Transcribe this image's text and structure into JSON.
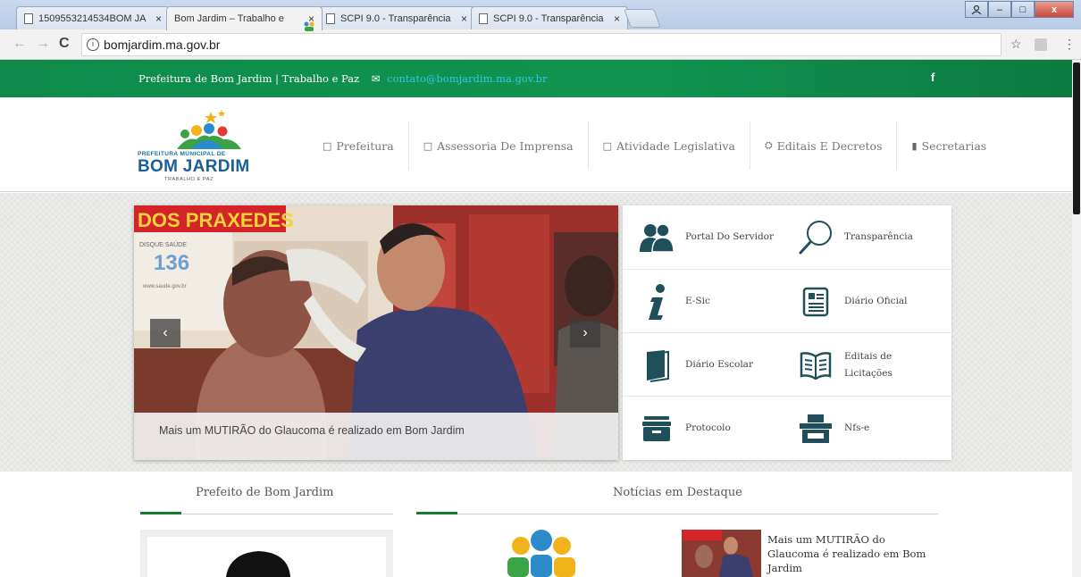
{
  "browser": {
    "tabs": [
      {
        "title": "1509553214534BOM JA",
        "icon": "page-icon"
      },
      {
        "title": "Bom Jardim – Trabalho e",
        "icon": "site-logo-icon"
      },
      {
        "title": "SCPI 9.0 - Transparência",
        "icon": "page-icon"
      },
      {
        "title": "SCPI 9.0 - Transparência",
        "icon": "page-icon"
      }
    ],
    "tab_close": "×",
    "url": "bomjardim.ma.gov.br",
    "back": "←",
    "forward": "→",
    "reload": "C",
    "star": "☆",
    "menu": "⋮",
    "win_min": "–",
    "win_max": "□",
    "win_close": "x"
  },
  "topbar": {
    "site_name": "Prefeitura de Bom Jardim | Trabalho e Paz",
    "mail_icon": "✉",
    "email": "contato@bomjardim.ma.gov.br",
    "facebook": "f",
    "color": "#11934f"
  },
  "logo": {
    "line1": "PREFEITURA MUNICIPAL DE",
    "line2": "BOM JARDIM",
    "line3": "TRABALHO E PAZ"
  },
  "nav": [
    {
      "icon": "□",
      "label": "Prefeitura"
    },
    {
      "icon": "□",
      "label": "Assessoria De Imprensa"
    },
    {
      "icon": "□",
      "label": "Atividade Legislativa"
    },
    {
      "icon": "⛭",
      "label": "Editais E Decretos"
    },
    {
      "icon": "▮",
      "label": "Secretarias"
    }
  ],
  "slider": {
    "caption": "Mais um MUTIRÃO do Glaucoma é realizado em Bom Jardim",
    "prev": "‹",
    "next": "›",
    "poster_title": "DOS PRAXEDES",
    "poster_sub": "DISQUE SAÚDE",
    "poster_number": "136",
    "poster_site": "www.saude.gov.br"
  },
  "quick_links": [
    {
      "label": "Portal Do Servidor",
      "icon": "users-icon"
    },
    {
      "label": "Transparência",
      "icon": "magnifier-icon"
    },
    {
      "label": "E-Sic",
      "icon": "info-icon"
    },
    {
      "label": "Diário Oficial",
      "icon": "newspaper-icon"
    },
    {
      "label": "Diário Escolar",
      "icon": "book-icon"
    },
    {
      "label": "Editais de Licitações",
      "icon": "open-book-icon"
    },
    {
      "label": "Protocolo",
      "icon": "archive-icon"
    },
    {
      "label": "Nfs-e",
      "icon": "printer-icon"
    }
  ],
  "sections": {
    "mayor_title": "Prefeito de Bom Jardim",
    "news_title": "Notícias em Destaque",
    "news_item": "Mais um MUTIRÃO do Glaucoma é realizado em Bom Jardim"
  },
  "colors": {
    "accent_green": "#1a7a32",
    "icon_teal": "#1f4f5a"
  }
}
